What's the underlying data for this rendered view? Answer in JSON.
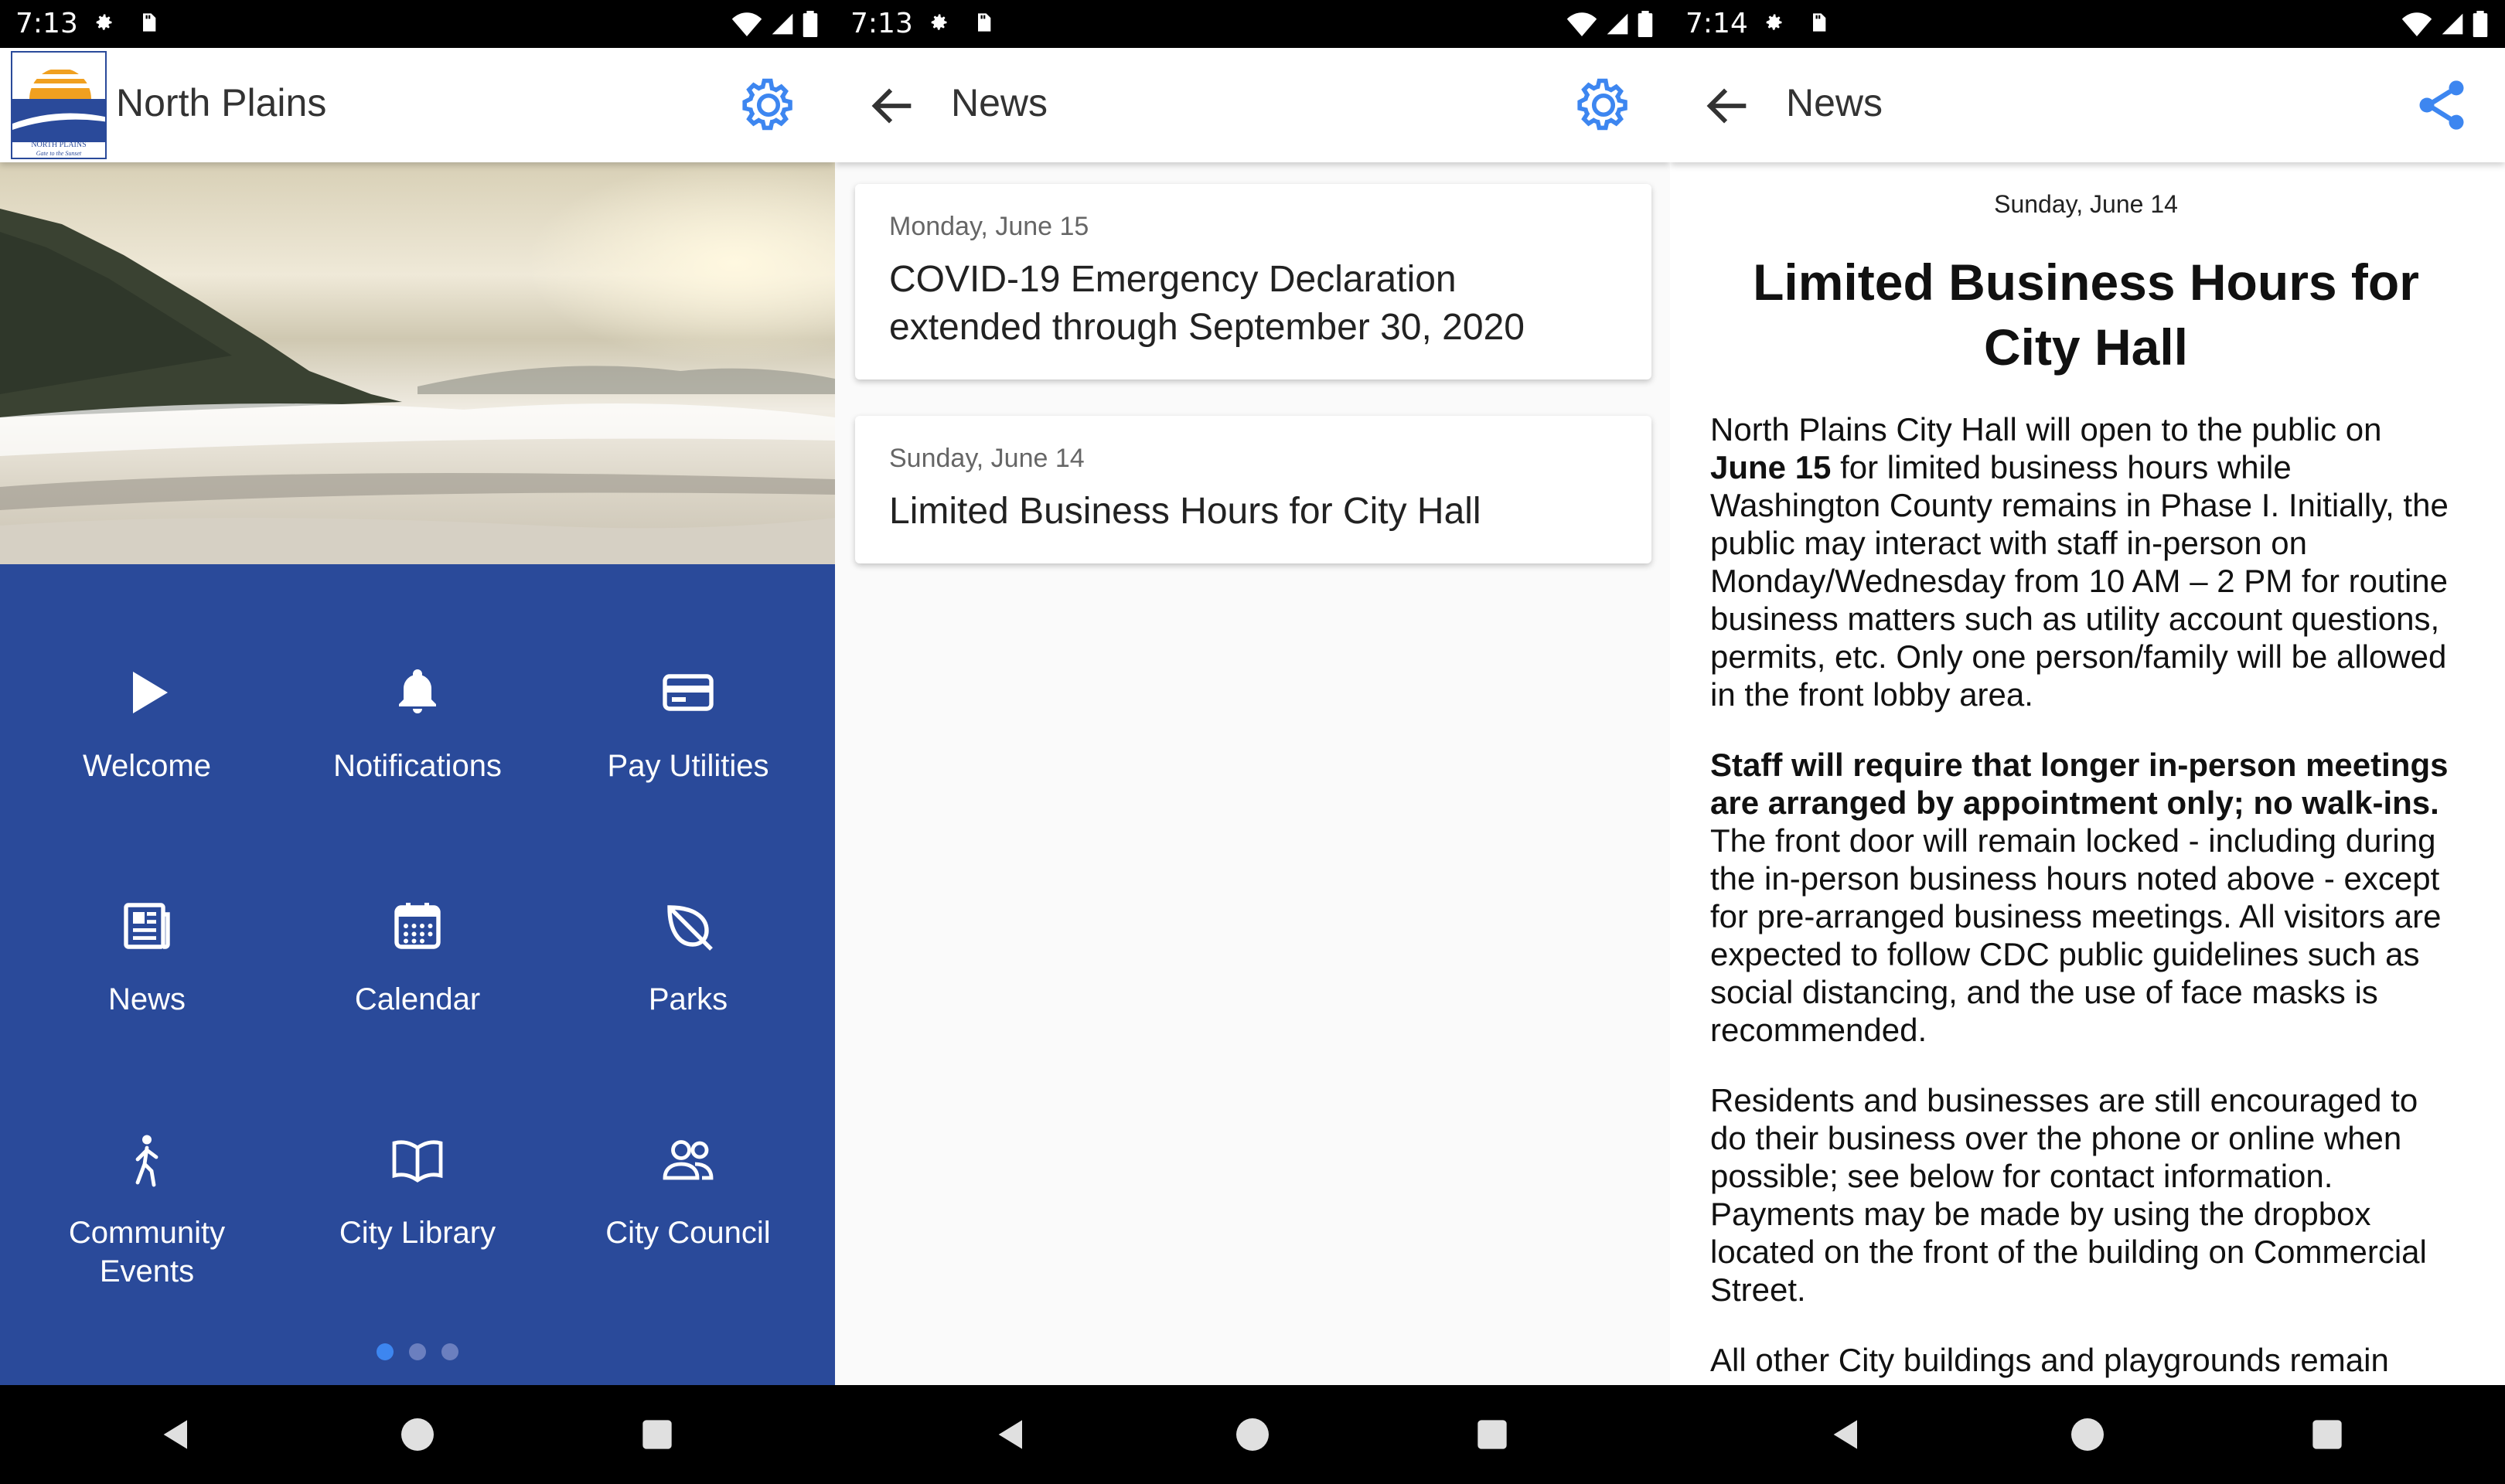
{
  "colors": {
    "brand_blue": "#2a4a9a",
    "accent_blue": "#3d86f0"
  },
  "panel1": {
    "status_time": "7:13",
    "app_title": "North Plains",
    "logo_text": "NORTH PLAINS",
    "logo_tagline": "Gate to the Sunset",
    "tiles": [
      {
        "label": "Welcome",
        "icon": "play-icon"
      },
      {
        "label": "Notifications",
        "icon": "bell-icon"
      },
      {
        "label": "Pay Utilities",
        "icon": "credit-card-icon"
      },
      {
        "label": "News",
        "icon": "newspaper-icon"
      },
      {
        "label": "Calendar",
        "icon": "calendar-icon"
      },
      {
        "label": "Parks",
        "icon": "leaf-icon"
      },
      {
        "label": "Community Events",
        "icon": "walking-person-icon"
      },
      {
        "label": "City Library",
        "icon": "open-book-icon"
      },
      {
        "label": "City Council",
        "icon": "people-icon"
      }
    ],
    "page_indicator": {
      "pages": 3,
      "active": 0
    }
  },
  "panel2": {
    "status_time": "7:13",
    "title": "News",
    "items": [
      {
        "date": "Monday, June 15",
        "headline": "COVID-19 Emergency Declaration extended through September 30, 2020"
      },
      {
        "date": "Sunday, June 14",
        "headline": "Limited Business Hours for City Hall"
      }
    ]
  },
  "panel3": {
    "status_time": "7:14",
    "title": "News",
    "date": "Sunday, June 14",
    "headline": "Limited Business Hours for City Hall",
    "p1_a": "North Plains City Hall will open to the public on ",
    "p1_b": "June 15",
    "p1_c": " for limited business hours while Washington County remains in Phase I. Initially, the public may interact with staff in-person on Monday/Wednesday from 10 AM – 2 PM for routine business matters such as utility account questions, permits, etc. Only one person/family will be allowed in the front lobby area.",
    "p2_a": "Staff will require that longer in-person meetings are arranged by appointment only; no walk-ins.",
    "p2_b": " The front door will remain locked - including during the in-person business hours noted above - except for pre-arranged business meetings. All visitors are expected to follow CDC public guidelines such as social distancing, and the use of face masks is recommended.",
    "p3": "Residents and businesses are still encouraged to do their business over the phone or online when possible; see below for contact information. Payments may be made by using the dropbox located on the front of the building on Commercial Street.",
    "p4": "All other City buildings and playgrounds remain"
  }
}
